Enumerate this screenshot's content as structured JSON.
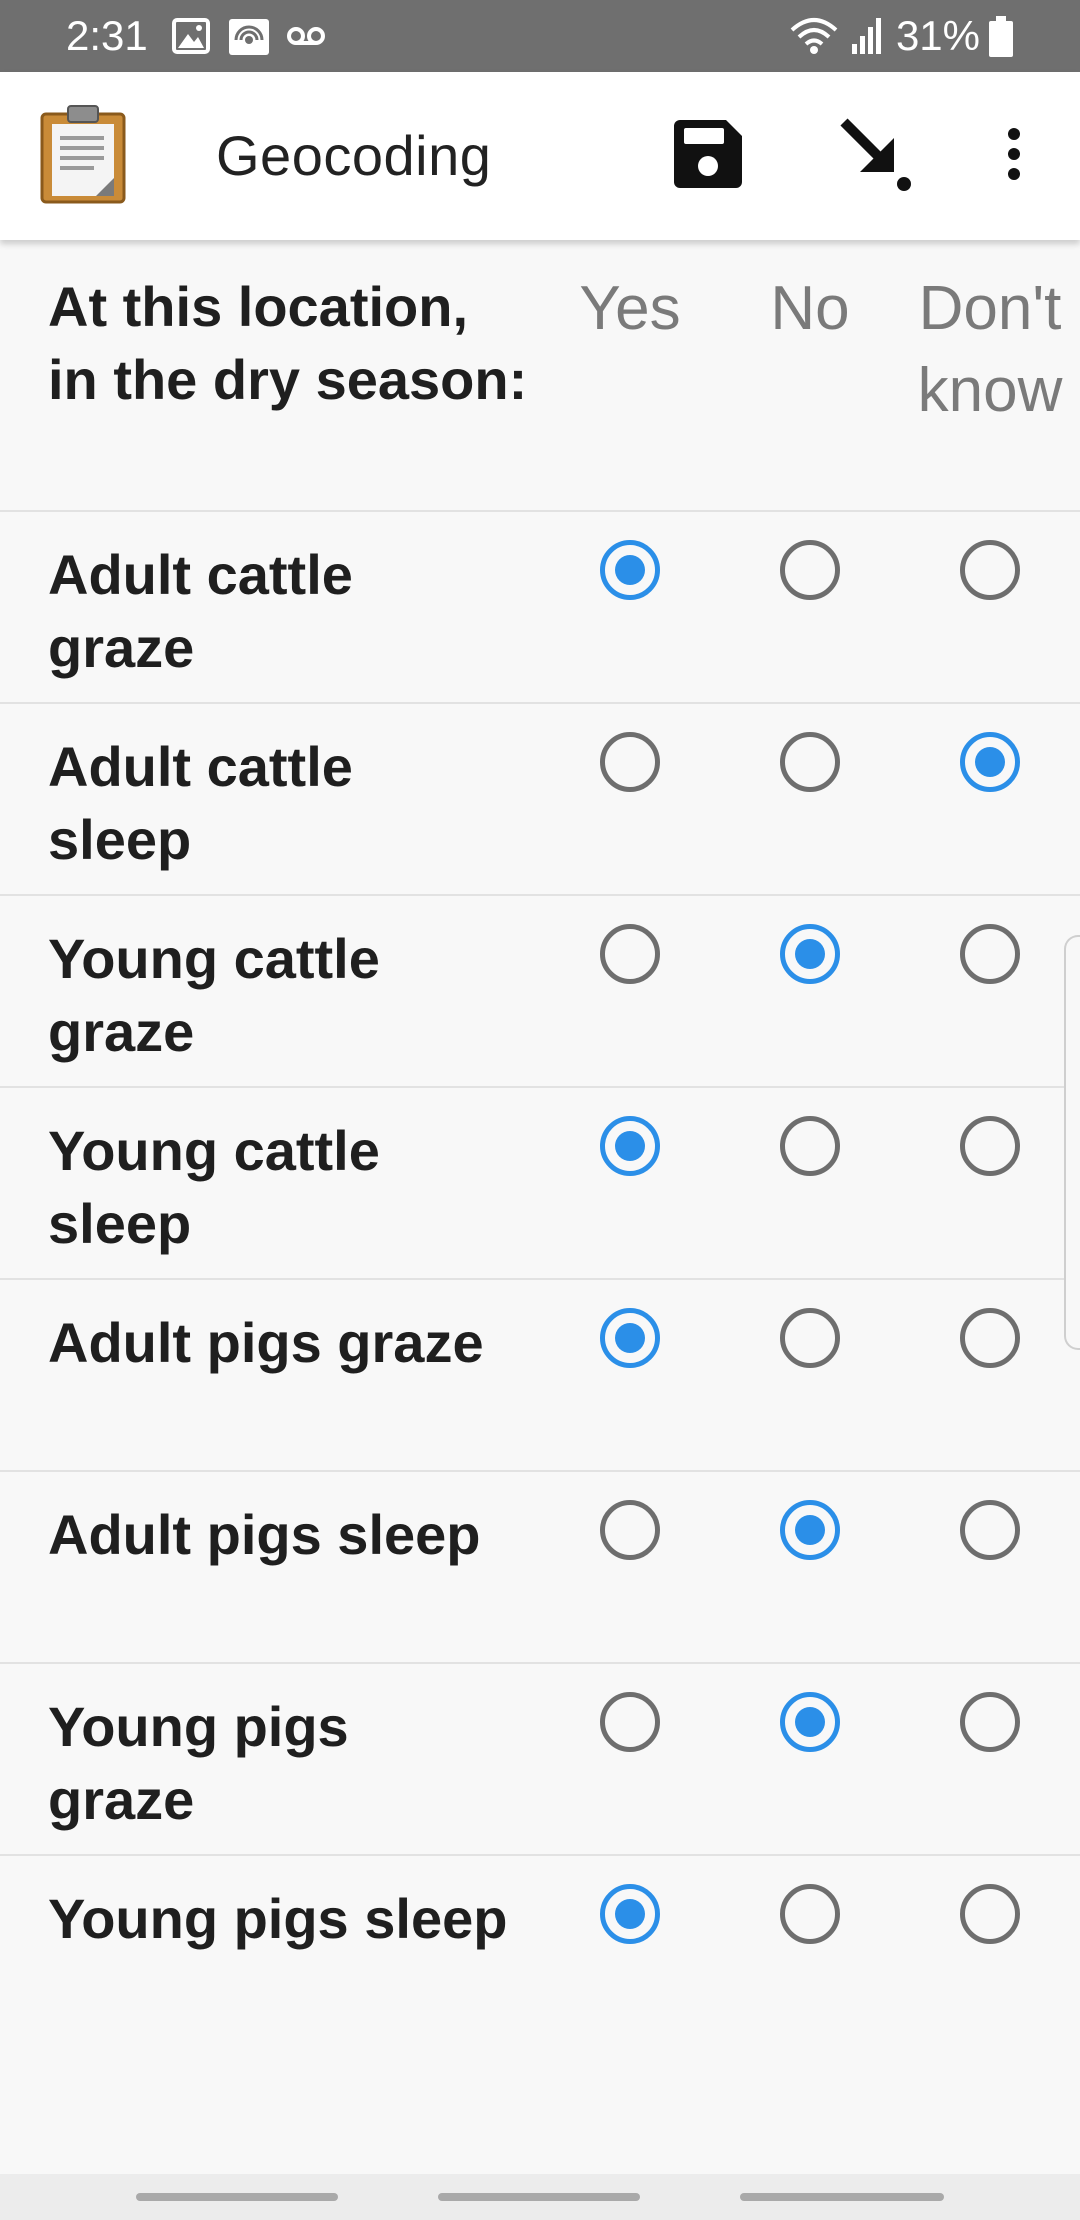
{
  "status_bar": {
    "time": "2:31",
    "left_icons": [
      "image-icon",
      "hotspot-icon",
      "voicemail-icon"
    ],
    "right_icons": [
      "wifi-icon",
      "signal-icon",
      "battery-icon"
    ],
    "battery": "31%"
  },
  "app_bar": {
    "logo_icon": "clipboard-icon",
    "title": "Geocoding",
    "actions": [
      "save-icon",
      "jump-icon",
      "more-vert-icon"
    ]
  },
  "grid": {
    "question": "At this location, in the dry season:",
    "columns": [
      "Yes",
      "No",
      "Don't know"
    ],
    "rows": [
      {
        "label": "Adult cattle graze",
        "selected": 0
      },
      {
        "label": "Adult cattle sleep",
        "selected": 2
      },
      {
        "label": "Young cattle graze",
        "selected": 1
      },
      {
        "label": "Young cattle sleep",
        "selected": 0
      },
      {
        "label": "Adult pigs graze",
        "selected": 0
      },
      {
        "label": "Adult pigs sleep",
        "selected": 1
      },
      {
        "label": "Young pigs graze",
        "selected": 1
      },
      {
        "label": "Young pigs sleep",
        "selected": 0
      }
    ]
  },
  "colors": {
    "accent": "#2b8fe8",
    "status_bar": "#6f6f6f",
    "app_bar": "#ffffff",
    "background": "#f8f8f8"
  }
}
